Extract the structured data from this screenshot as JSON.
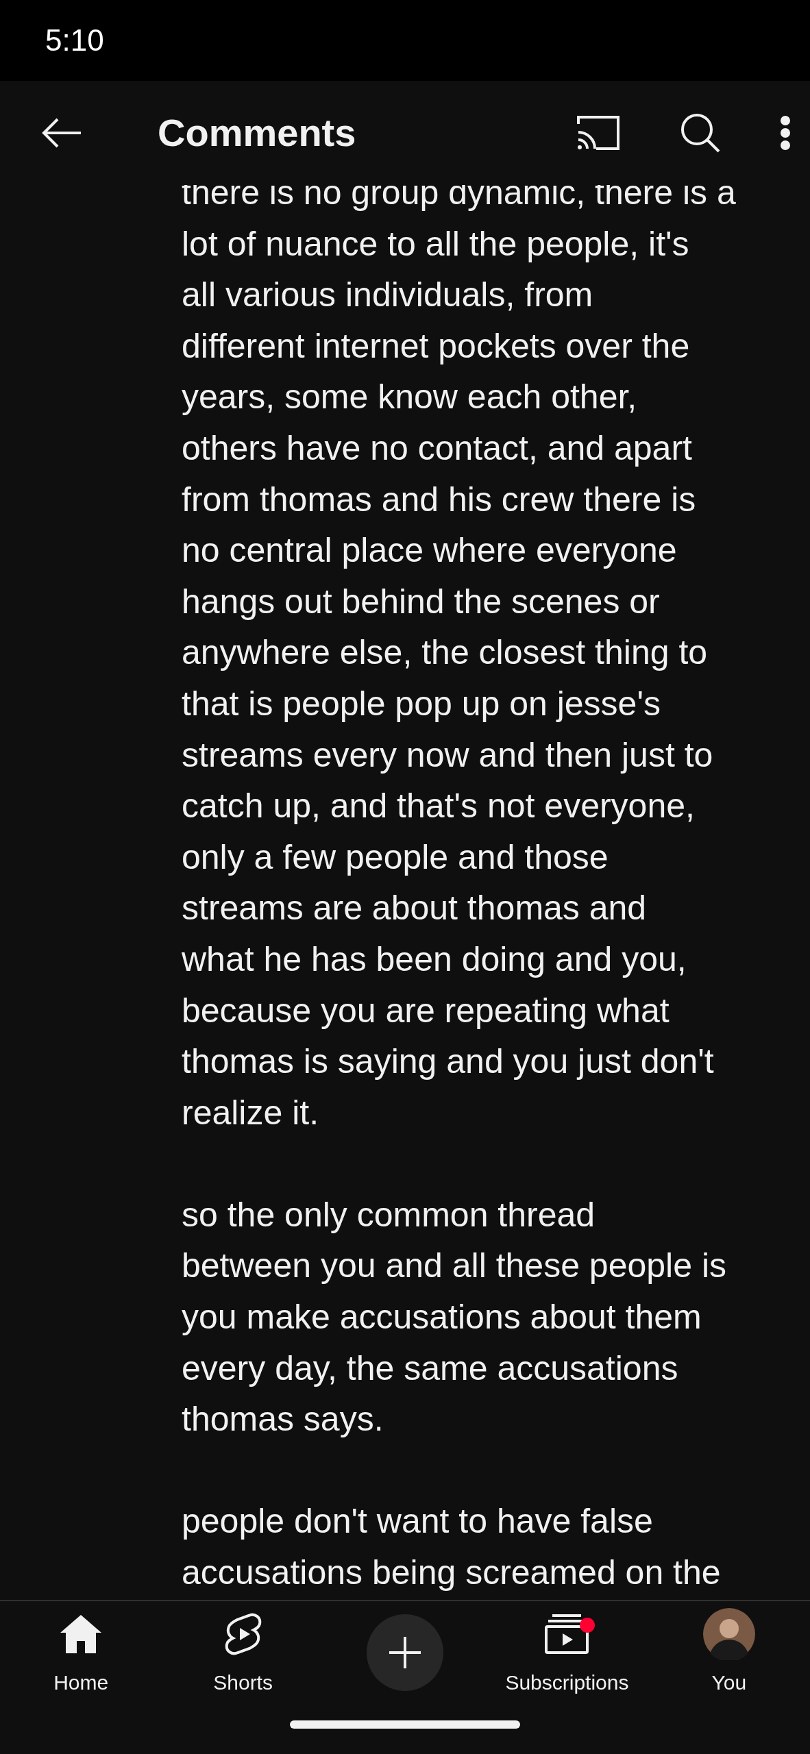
{
  "status_bar": {
    "time": "5:10"
  },
  "app_bar": {
    "title": "Comments"
  },
  "comment_paragraphs": [
    {
      "lines": [
        "there is no group dynamic, there is a",
        "lot of nuance to all the people, it's",
        "all various individuals, from",
        "different internet pockets over the",
        "years, some know each other,",
        "others have no contact, and apart",
        "from thomas and his crew there is",
        "no central place where everyone",
        "hangs out behind the scenes or",
        "anywhere else, the closest thing to",
        "that is people pop up on jesse's",
        "streams every now and then just to",
        "catch up, and that's not everyone,",
        "only a few people and those",
        "streams are about thomas and",
        "what he has been doing and you,",
        "because you are repeating what",
        "thomas is saying and you just don't",
        "realize it."
      ]
    },
    {
      "lines": [
        "so the only common thread",
        "between you and all these people is",
        "you make accusations about them",
        "every day, the same accusations",
        "thomas says."
      ]
    },
    {
      "lines": [
        "people don't want to have false",
        "accusations being screamed on the"
      ]
    }
  ],
  "bottom_nav": [
    {
      "kind": "home",
      "label": "Home",
      "selected": true,
      "notification": false
    },
    {
      "kind": "shorts",
      "label": "Shorts",
      "selected": false,
      "notification": false
    },
    {
      "kind": "create"
    },
    {
      "kind": "subscriptions",
      "label": "Subscriptions",
      "selected": false,
      "notification": true
    },
    {
      "kind": "you",
      "label": "You",
      "selected": false,
      "notification": false
    }
  ]
}
